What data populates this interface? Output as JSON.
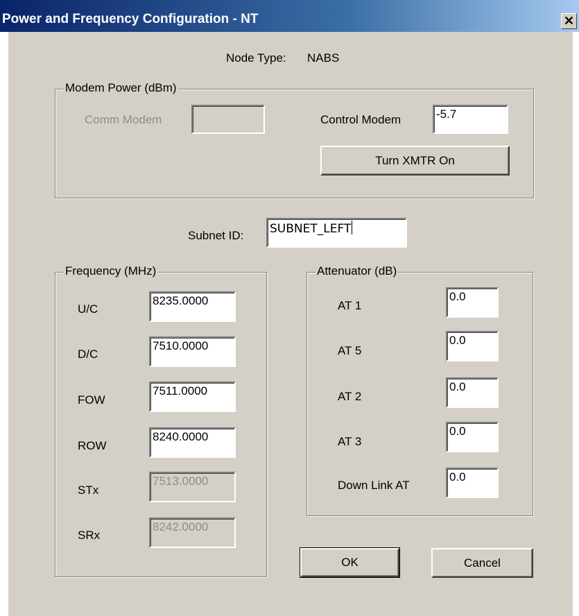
{
  "window": {
    "title": "Power and Frequency Configuration - NT",
    "close_glyph": "✕"
  },
  "node_type": {
    "label": "Node Type:",
    "value": "NABS"
  },
  "modem_power": {
    "legend": "Modem Power (dBm)",
    "comm_modem_label": "Comm Modem",
    "comm_modem_value": "",
    "control_modem_label": "Control Modem",
    "control_modem_value": "-5.7",
    "xmtr_button": "Turn XMTR On"
  },
  "subnet": {
    "label": "Subnet ID:",
    "value": "SUBNET_LEFT"
  },
  "frequency": {
    "legend": "Frequency (MHz)",
    "rows": [
      {
        "label": "U/C",
        "value": "8235.0000",
        "enabled": true
      },
      {
        "label": "D/C",
        "value": "7510.0000",
        "enabled": true
      },
      {
        "label": "FOW",
        "value": "7511.0000",
        "enabled": true
      },
      {
        "label": "ROW",
        "value": "8240.0000",
        "enabled": true
      },
      {
        "label": "STx",
        "value": "7513.0000",
        "enabled": false
      },
      {
        "label": "SRx",
        "value": "8242.0000",
        "enabled": false
      }
    ]
  },
  "attenuator": {
    "legend": "Attenuator (dB)",
    "rows": [
      {
        "label": "AT 1",
        "value": "0.0"
      },
      {
        "label": "AT 5",
        "value": "0.0"
      },
      {
        "label": "AT 2",
        "value": "0.0"
      },
      {
        "label": "AT 3",
        "value": "0.0"
      },
      {
        "label": "Down Link AT",
        "value": "0.0"
      }
    ]
  },
  "buttons": {
    "ok": "OK",
    "cancel": "Cancel"
  },
  "colors": {
    "dialog_bg": "#d4d0c8",
    "titlebar_start": "#0a246a",
    "titlebar_end": "#a6caf0",
    "disabled_text": "#8d8d8d"
  }
}
